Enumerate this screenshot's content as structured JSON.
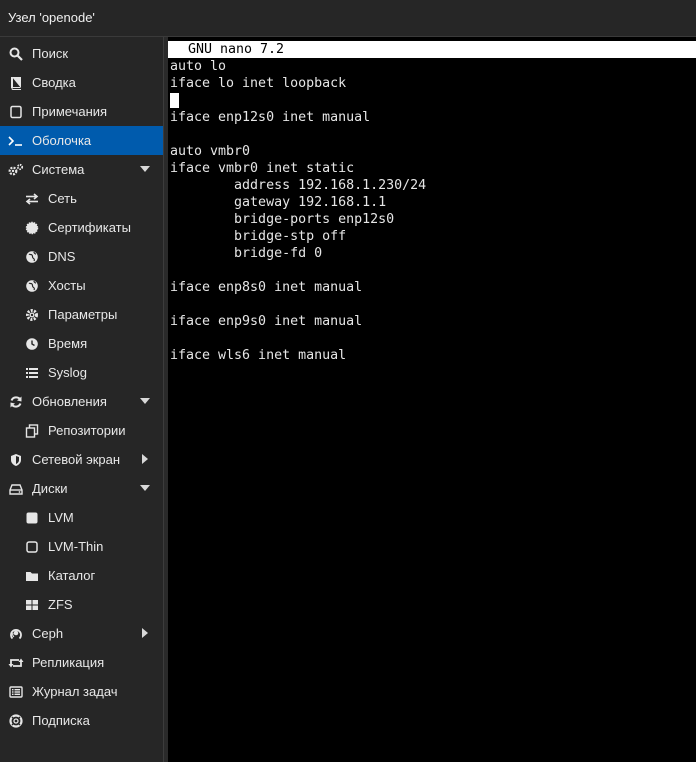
{
  "window": {
    "title": "Узел 'openode'"
  },
  "colors": {
    "active": "#005bad",
    "sidebar_bg": "#262626",
    "terminal_bg": "#000000"
  },
  "sidebar": {
    "items": [
      {
        "label": "Поиск",
        "icon": "search-icon",
        "level": 0
      },
      {
        "label": "Сводка",
        "icon": "book-icon",
        "level": 0
      },
      {
        "label": "Примечания",
        "icon": "note-icon",
        "level": 0
      },
      {
        "label": "Оболочка",
        "icon": "terminal-icon",
        "level": 0,
        "active": true
      },
      {
        "label": "Система",
        "icon": "cogs-icon",
        "level": 0,
        "expand": "down"
      },
      {
        "label": "Сеть",
        "icon": "exchange-icon",
        "level": 1
      },
      {
        "label": "Сертификаты",
        "icon": "certificate-icon",
        "level": 1
      },
      {
        "label": "DNS",
        "icon": "globe-icon",
        "level": 1
      },
      {
        "label": "Хосты",
        "icon": "globe-icon",
        "level": 1
      },
      {
        "label": "Параметры",
        "icon": "gear-icon",
        "level": 1
      },
      {
        "label": "Время",
        "icon": "clock-icon",
        "level": 1
      },
      {
        "label": "Syslog",
        "icon": "list-icon",
        "level": 1
      },
      {
        "label": "Обновления",
        "icon": "refresh-icon",
        "level": 0,
        "expand": "down"
      },
      {
        "label": "Репозитории",
        "icon": "files-icon",
        "level": 1
      },
      {
        "label": "Сетевой экран",
        "icon": "shield-icon",
        "level": 0,
        "expand": "right"
      },
      {
        "label": "Диски",
        "icon": "drive-icon",
        "level": 0,
        "expand": "down"
      },
      {
        "label": "LVM",
        "icon": "square-icon",
        "level": 1
      },
      {
        "label": "LVM-Thin",
        "icon": "square-outline-icon",
        "level": 1
      },
      {
        "label": "Каталог",
        "icon": "folder-icon",
        "level": 1
      },
      {
        "label": "ZFS",
        "icon": "grid-icon",
        "level": 1
      },
      {
        "label": "Ceph",
        "icon": "ceph-icon",
        "level": 0,
        "expand": "right"
      },
      {
        "label": "Репликация",
        "icon": "retweet-icon",
        "level": 0
      },
      {
        "label": "Журнал задач",
        "icon": "list-alt-icon",
        "level": 0
      },
      {
        "label": "Подписка",
        "icon": "support-icon",
        "level": 0
      }
    ]
  },
  "terminal": {
    "header": "GNU nano 7.2",
    "lines": [
      "auto lo",
      "iface lo inet loopback",
      "",
      "iface enp12s0 inet manual",
      "",
      "auto vmbr0",
      "iface vmbr0 inet static",
      "        address 192.168.1.230/24",
      "        gateway 192.168.1.1",
      "        bridge-ports enp12s0",
      "        bridge-stp off",
      "        bridge-fd 0",
      "",
      "iface enp8s0 inet manual",
      "",
      "iface enp9s0 inet manual",
      "",
      "iface wls6 inet manual"
    ]
  }
}
